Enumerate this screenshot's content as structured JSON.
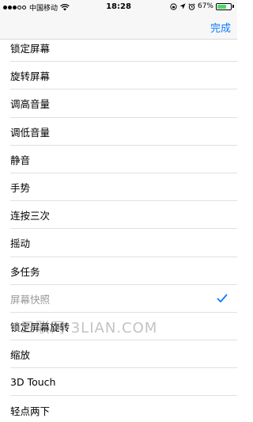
{
  "status_bar": {
    "carrier": "中国移动",
    "time": "18:28",
    "battery_percent": "67%",
    "battery_level": 0.67,
    "signal_bars_filled": 3,
    "signal_bars_total": 5
  },
  "nav": {
    "done_label": "完成",
    "accent_color": "#0a7aff"
  },
  "list": {
    "items": [
      {
        "label": "锁定屏幕",
        "selected": false
      },
      {
        "label": "旋转屏幕",
        "selected": false
      },
      {
        "label": "调高音量",
        "selected": false
      },
      {
        "label": "调低音量",
        "selected": false
      },
      {
        "label": "静音",
        "selected": false
      },
      {
        "label": "手势",
        "selected": false
      },
      {
        "label": "连按三次",
        "selected": false
      },
      {
        "label": "摇动",
        "selected": false
      },
      {
        "label": "多任务",
        "selected": false
      },
      {
        "label": "屏幕快照",
        "selected": true
      },
      {
        "label": "锁定屏幕旋转",
        "selected": false
      },
      {
        "label": "缩放",
        "selected": false
      },
      {
        "label": "3D Touch",
        "selected": false
      },
      {
        "label": "轻点两下",
        "selected": false
      }
    ]
  },
  "watermark": "三联网 3LIAN.COM"
}
